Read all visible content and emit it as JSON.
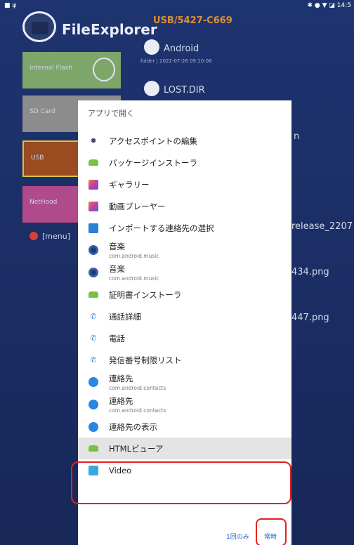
{
  "app": {
    "title": "FileExplorer",
    "path": "USB/5427-C669"
  },
  "statusbar": {
    "left_icons": "■ ψ",
    "right": "✱ ● ▼ ◪  14:5"
  },
  "sidebar": {
    "items": [
      {
        "label": "Internal Flash",
        "color": "#7fa66a"
      },
      {
        "label": "SD Card",
        "color": "#8c8c8c"
      },
      {
        "label": "USB",
        "color": "#9a4b1f"
      },
      {
        "label": "NetHood",
        "color": "#b04a8a"
      }
    ],
    "menu_hint": "[menu]"
  },
  "background_files": {
    "top_partial": "Android",
    "folder_meta": "folder | 2022-07-26 09:10:06",
    "lost_dir": "LOST.DIR",
    "partial_n": "n",
    "release": "release_2207",
    "png1": "434.png",
    "png2": "447.png"
  },
  "dialog": {
    "title": "アプリで開く",
    "items": [
      {
        "icon": "gear-icon",
        "label": "アクセスポイントの編集",
        "sub": ""
      },
      {
        "icon": "android-icon",
        "label": "パッケージインストーラ",
        "sub": ""
      },
      {
        "icon": "gallery-icon",
        "label": "ギャラリー",
        "sub": ""
      },
      {
        "icon": "video-player-icon",
        "label": "動画プレーヤー",
        "sub": ""
      },
      {
        "icon": "contact-import-icon",
        "label": "インポートする連絡先の選択",
        "sub": ""
      },
      {
        "icon": "music-icon",
        "label": "音楽",
        "sub": "com.android.music"
      },
      {
        "icon": "music-icon",
        "label": "音楽",
        "sub": "com.android.music"
      },
      {
        "icon": "android-icon",
        "label": "証明書インストーラ",
        "sub": ""
      },
      {
        "icon": "phone-icon",
        "label": "通話詳細",
        "sub": ""
      },
      {
        "icon": "phone-icon",
        "label": "電話",
        "sub": ""
      },
      {
        "icon": "phone-icon",
        "label": "発信番号制限リスト",
        "sub": ""
      },
      {
        "icon": "contacts-icon",
        "label": "連絡先",
        "sub": "com.android.contacts"
      },
      {
        "icon": "contacts-icon",
        "label": "連絡先",
        "sub": "com.android.contacts"
      },
      {
        "icon": "contacts-icon",
        "label": "連絡先の表示",
        "sub": ""
      },
      {
        "icon": "android-icon",
        "label": "HTMLビューア",
        "sub": ""
      },
      {
        "icon": "video-icon",
        "label": "Video",
        "sub": ""
      }
    ],
    "selected_index": 14,
    "button_once": "1回のみ",
    "button_always": "常時"
  }
}
